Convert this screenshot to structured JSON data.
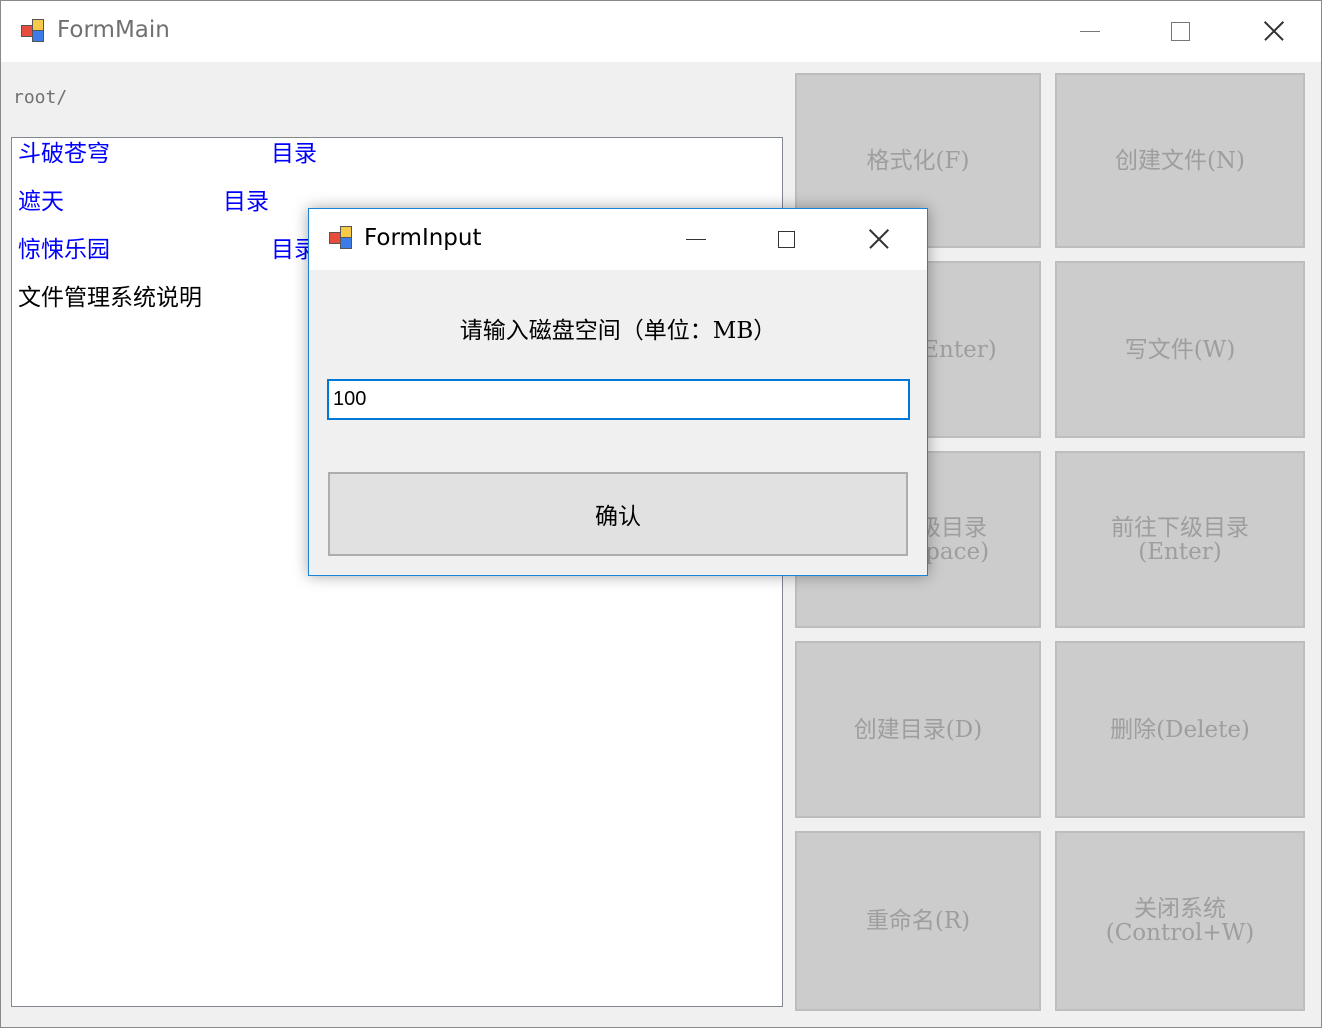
{
  "main_window": {
    "title": "FormMain",
    "path": "root/",
    "entries": [
      {
        "name": "斗破苍穹",
        "type": "目录",
        "kind": "folder"
      },
      {
        "name": "遮天",
        "type": "目录",
        "kind": "folder"
      },
      {
        "name": "惊悚乐园",
        "type": "目录",
        "kind": "folder"
      },
      {
        "name": "文件管理系统说明",
        "type": "",
        "kind": "file"
      }
    ],
    "buttons": [
      {
        "line1": "格式化(F)",
        "line2": ""
      },
      {
        "line1": "创建文件(N)",
        "line2": ""
      },
      {
        "line1": "打开(Enter)",
        "line2": ""
      },
      {
        "line1": "写文件(W)",
        "line2": ""
      },
      {
        "line1": "返回上级目录",
        "line2": "(Backspace)"
      },
      {
        "line1": "前往下级目录",
        "line2": "(Enter)"
      },
      {
        "line1": "创建目录(D)",
        "line2": ""
      },
      {
        "line1": "删除(Delete)",
        "line2": ""
      },
      {
        "line1": "重命名(R)",
        "line2": ""
      },
      {
        "line1": "关闭系统",
        "line2": "(Control+W)"
      }
    ]
  },
  "dialog": {
    "title": "FormInput",
    "prompt": "请输入磁盘空间（单位：MB）",
    "input_value": "100",
    "confirm_label": "确认"
  },
  "icons": {
    "app_icon": "app-window-icon",
    "minimize": "minimize-icon",
    "maximize": "maximize-icon",
    "close": "close-icon"
  }
}
